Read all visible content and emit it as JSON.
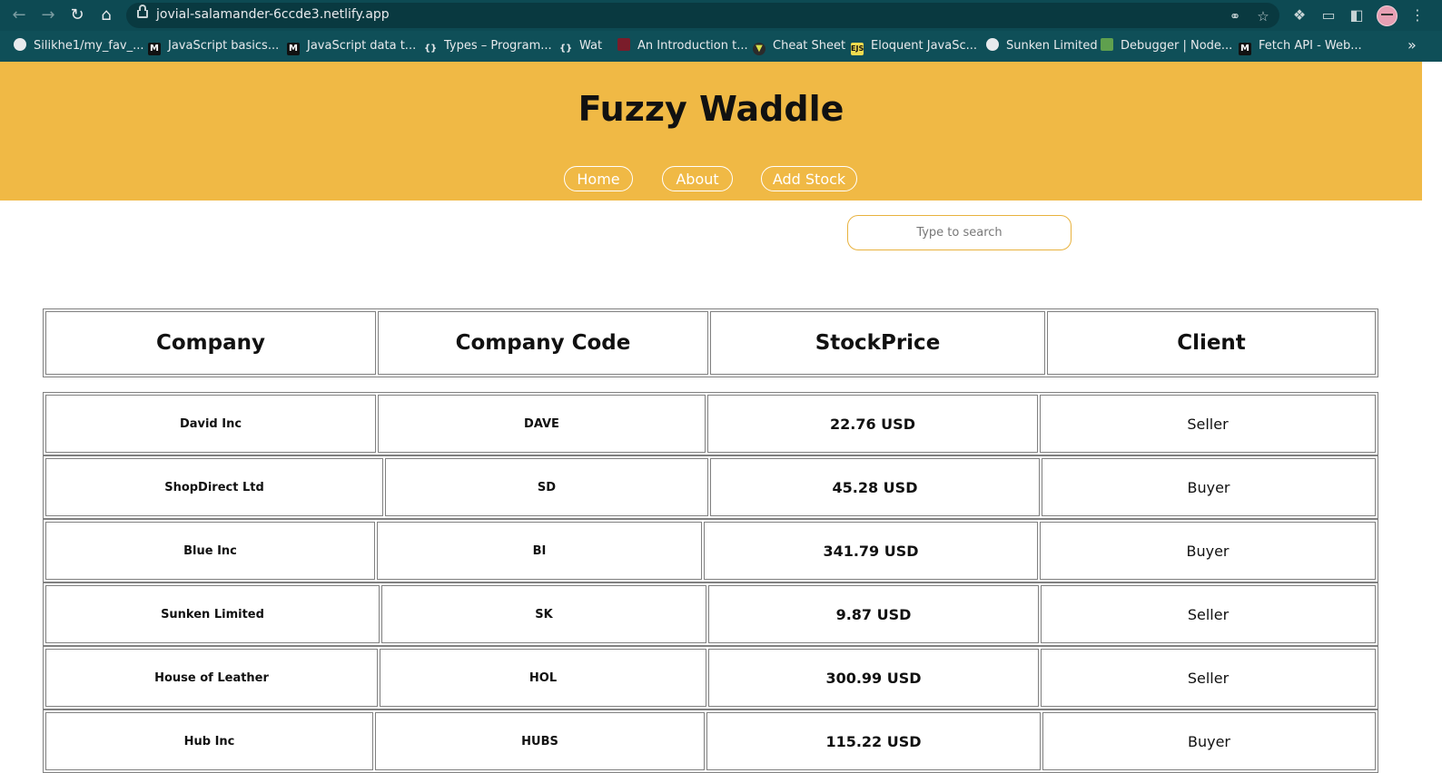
{
  "browser": {
    "url": "jovial-salamander-6ccde3.netlify.app",
    "bookmarks": [
      {
        "label": "Silikhe1/my_fav_...",
        "icon": "github-icon"
      },
      {
        "label": "JavaScript basics...",
        "icon": "medium-icon"
      },
      {
        "label": "JavaScript data t...",
        "icon": "medium-icon"
      },
      {
        "label": "Types – Program...",
        "icon": "braces-icon"
      },
      {
        "label": "Wat",
        "icon": "braces-icon"
      },
      {
        "label": "An Introduction t...",
        "icon": "page-icon"
      },
      {
        "label": "Cheat Sheet",
        "icon": "shield-icon"
      },
      {
        "label": "Eloquent JavaSc...",
        "icon": "ejs-icon"
      },
      {
        "label": "Sunken Limited",
        "icon": "globe-icon"
      },
      {
        "label": "Debugger | Node...",
        "icon": "node-icon"
      },
      {
        "label": "Fetch API - Web...",
        "icon": "medium-icon"
      }
    ]
  },
  "header": {
    "title": "Fuzzy Waddle",
    "nav": [
      "Home",
      "About",
      "Add Stock"
    ]
  },
  "search": {
    "placeholder": "Type to search"
  },
  "table": {
    "columns": [
      "Company",
      "Company Code",
      "StockPrice",
      "Client"
    ],
    "rows": [
      {
        "company": "David Inc",
        "code": "DAVE",
        "price": "22.76 USD",
        "client": "Seller"
      },
      {
        "company": "ShopDirect Ltd",
        "code": "SD",
        "price": "45.28 USD",
        "client": "Buyer"
      },
      {
        "company": "Blue Inc",
        "code": "BI",
        "price": "341.79 USD",
        "client": "Buyer"
      },
      {
        "company": "Sunken Limited",
        "code": "SK",
        "price": "9.87 USD",
        "client": "Seller"
      },
      {
        "company": "House of Leather",
        "code": "HOL",
        "price": "300.99 USD",
        "client": "Seller"
      },
      {
        "company": "Hub Inc",
        "code": "HUBS",
        "price": "115.22 USD",
        "client": "Buyer"
      }
    ]
  },
  "colors": {
    "header_bg": "#f0b945",
    "chrome_bg": "#0d4a53",
    "border": "#808080"
  }
}
